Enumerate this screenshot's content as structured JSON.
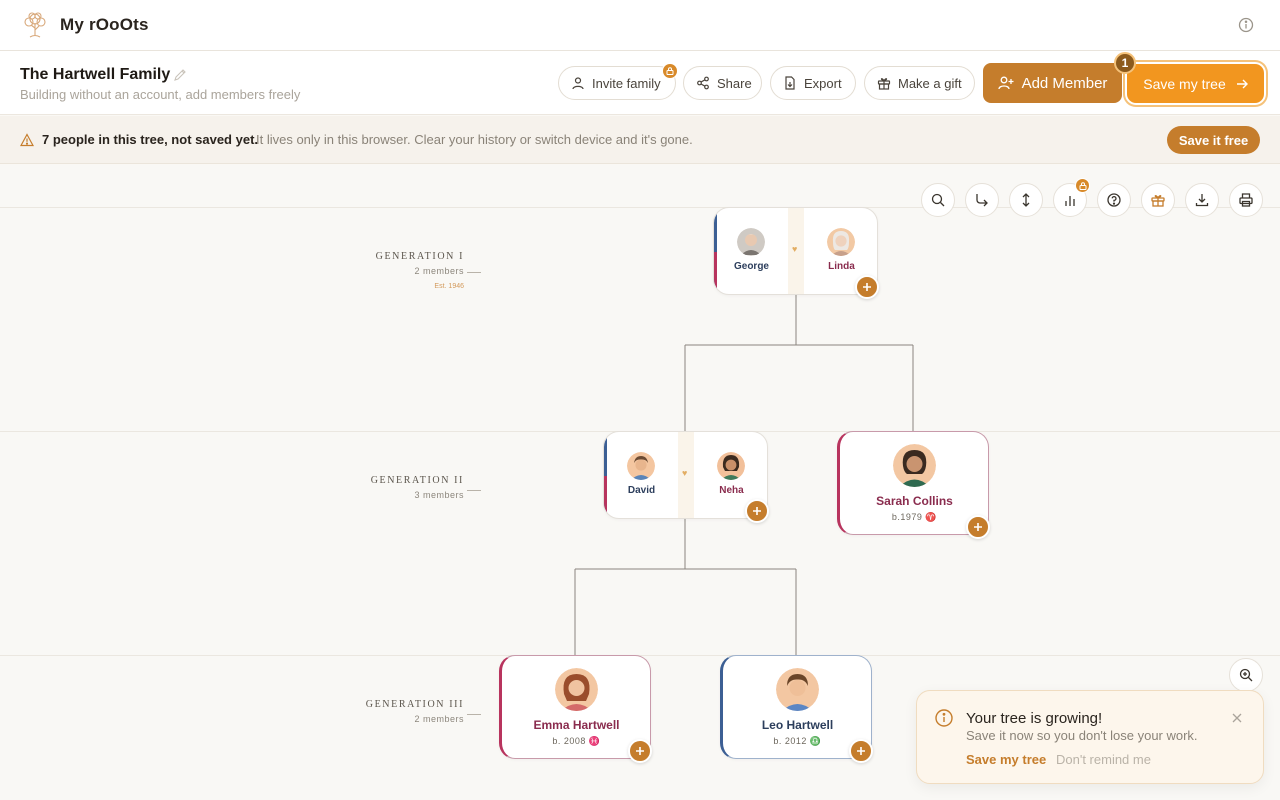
{
  "app": {
    "title": "My rOoOts"
  },
  "header": {
    "tree_name": "The Hartwell Family",
    "subtitle": "Building without an account, add members freely",
    "actions": {
      "invite": "Invite family",
      "share": "Share",
      "export": "Export",
      "gift": "Make a gift",
      "add_member": "Add Member",
      "save_tree": "Save my tree",
      "step": "1"
    }
  },
  "banner": {
    "strong": "7 people in this tree, not saved yet.",
    "text": "It lives only in this browser. Clear your history or switch device and it's gone.",
    "button": "Save it free"
  },
  "toolbar": [
    "search-icon",
    "redirect-arrow-icon",
    "vertical-arrows-icon",
    "bar-chart-icon",
    "help-icon",
    "gift-icon",
    "download-icon",
    "print-icon"
  ],
  "generations": [
    {
      "title": "GENERATION I",
      "count": "2 members",
      "est": "Est. 1946"
    },
    {
      "title": "GENERATION II",
      "count": "3 members"
    },
    {
      "title": "GENERATION III",
      "count": "2 members"
    }
  ],
  "people": {
    "george": {
      "name": "George"
    },
    "linda": {
      "name": "Linda"
    },
    "david": {
      "name": "David"
    },
    "neha": {
      "name": "Neha"
    },
    "sarah": {
      "name": "Sarah Collins",
      "born": "b.1979 ♈"
    },
    "emma": {
      "name": "Emma Hartwell",
      "born": "b. 2008 ♓"
    },
    "leo": {
      "name": "Leo Hartwell",
      "born": "b. 2012 ♎"
    }
  },
  "colors": {
    "accent": "#c57d2c",
    "save": "#f2961f",
    "female": "#b8345e",
    "male": "#3c5f94"
  },
  "toast": {
    "title": "Your tree is growing!",
    "body": "Save it now so you don't lose your work.",
    "save": "Save my tree",
    "dismiss": "Don't remind me"
  }
}
